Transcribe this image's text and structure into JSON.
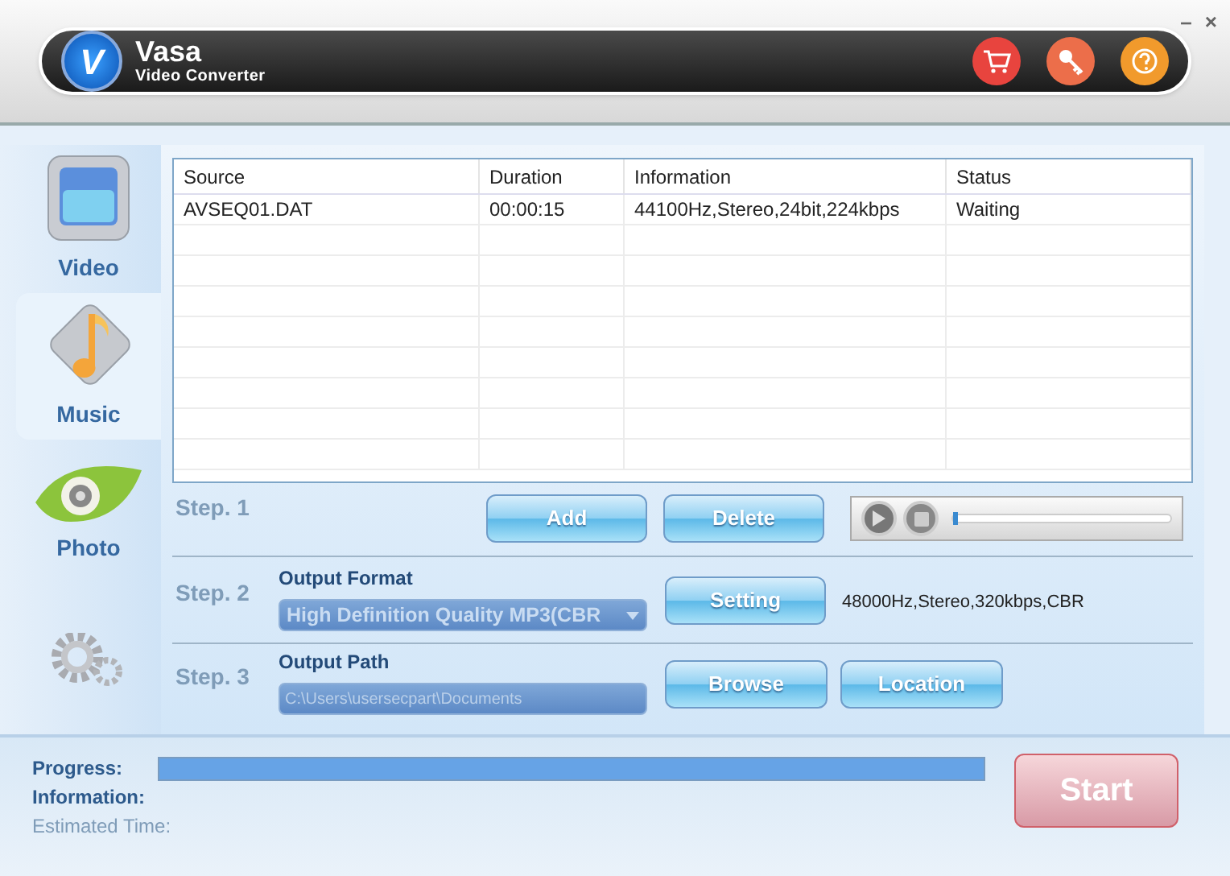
{
  "header": {
    "logo_letter": "V",
    "title": "Vasa",
    "subtitle": "Video Converter"
  },
  "window_controls": [
    "–",
    "×"
  ],
  "sidebar": [
    {
      "label": "Video",
      "kind": "video",
      "selected": false
    },
    {
      "label": "Music",
      "kind": "music",
      "selected": true
    },
    {
      "label": "Photo",
      "kind": "photo",
      "selected": false
    },
    {
      "kind": "settings",
      "selected": false
    }
  ],
  "table": {
    "columns": [
      "Source",
      "Duration",
      "Information",
      "Status"
    ],
    "rows": [
      [
        "AVSEQ01.DAT",
        "00:00:15",
        "44100Hz,Stereo,24bit,224kbps",
        "Waiting"
      ]
    ]
  },
  "step1": {
    "label": "Step. 1",
    "buttons": [
      "Add",
      "Delete"
    ],
    "player": {
      "level": 0.02
    }
  },
  "step2": {
    "label": "Step. 2",
    "title": "Output Format",
    "format": "High Definition Quality MP3(CBR",
    "button": "Setting",
    "info": "48000Hz,Stereo,320kbps,CBR"
  },
  "step3": {
    "label": "Step. 3",
    "title": "Output Path",
    "path": "C:\\Users\\usersecpart\\Documents",
    "buttons": [
      "Browse",
      "Location"
    ]
  },
  "status": {
    "progress_label": "Progress:",
    "progress": {
      "level": 1
    },
    "information_label": "Information:",
    "estimated_label": "Estimated Time:",
    "start_button": "Start"
  }
}
